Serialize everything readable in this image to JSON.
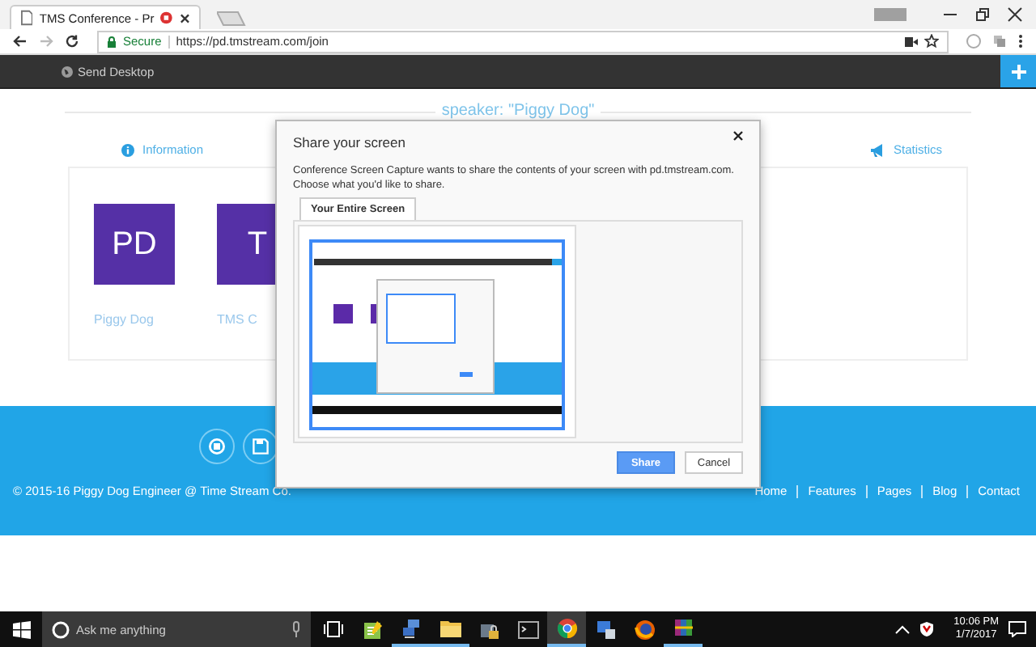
{
  "browser": {
    "tab": {
      "title": "TMS Conference - Pr",
      "recording": true
    },
    "address": {
      "secure_label": "Secure",
      "url": "https://pd.tmstream.com/join"
    }
  },
  "navbar": {
    "label": "Send Desktop"
  },
  "page": {
    "heading": "speaker: \"Piggy Dog\"",
    "tabs": [
      {
        "label": "Information",
        "kind": "info"
      },
      {
        "label": "Statistics",
        "kind": "stats"
      }
    ],
    "participants": [
      {
        "initials": "PD",
        "name": "Piggy Dog"
      },
      {
        "initials": "T",
        "name": "TMS C"
      }
    ]
  },
  "footer": {
    "copyright": "© 2015-16 Piggy Dog Engineer @ Time Stream Co.",
    "links": [
      "Home",
      "Features",
      "Pages",
      "Blog",
      "Contact"
    ]
  },
  "dialog": {
    "title": "Share your screen",
    "message": "Conference Screen Capture wants to share the contents of your screen with pd.tmstream.com. Choose what you'd like to share.",
    "tabs": [
      {
        "label": "Your Entire Screen",
        "selected": true
      }
    ],
    "buttons": [
      {
        "label": "Share",
        "kind": "primary"
      },
      {
        "label": "Cancel",
        "kind": "secondary"
      }
    ]
  },
  "taskbar": {
    "search_placeholder": "Ask me anything",
    "apps": [
      {
        "kind": "notepad",
        "running": false,
        "active": false
      },
      {
        "kind": "network",
        "running": true,
        "active": false
      },
      {
        "kind": "folder",
        "running": true,
        "active": false
      },
      {
        "kind": "lock",
        "running": false,
        "active": false
      },
      {
        "kind": "terminal",
        "running": false,
        "active": false
      },
      {
        "kind": "chrome",
        "running": true,
        "active": true
      },
      {
        "kind": "computer",
        "running": false,
        "active": false
      },
      {
        "kind": "firefox",
        "running": false,
        "active": false
      },
      {
        "kind": "archive",
        "running": true,
        "active": false
      }
    ],
    "time": "10:06 PM",
    "date": "1/7/2017"
  }
}
